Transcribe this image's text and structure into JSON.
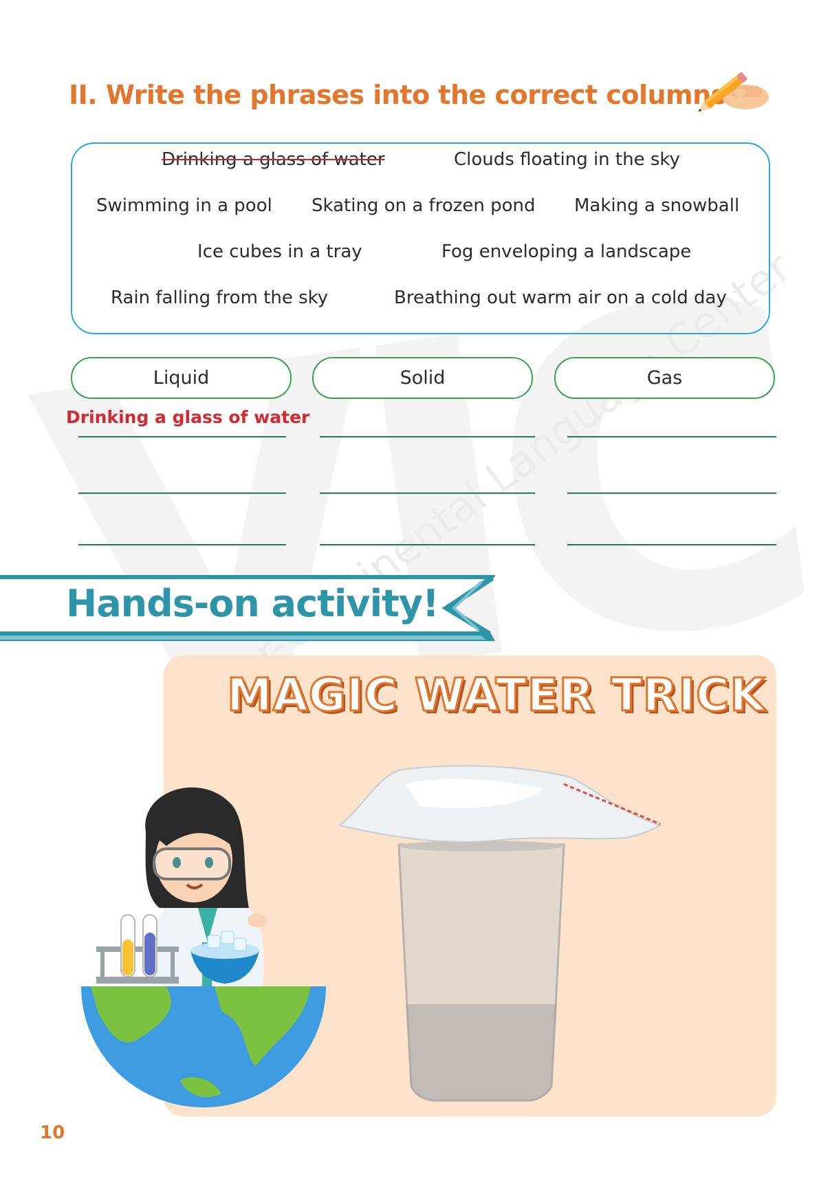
{
  "watermark": {
    "letters": "VIC",
    "text": "Inter-Continental Language Center"
  },
  "exercise": {
    "heading": "II. Write the phrases into the correct columns.",
    "phrases": [
      "Drinking a glass of water",
      "Clouds floating in the sky",
      "Swimming in a pool",
      "Skating on a frozen pond",
      "Making a snowball",
      "Ice cubes in a tray",
      "Fog enveloping a landscape",
      "Rain falling from the sky",
      "Breathing out warm air on a cold day"
    ],
    "columns": [
      "Liquid",
      "Solid",
      "Gas"
    ],
    "example_answer": "Drinking a glass of water"
  },
  "activity": {
    "banner_title": "Hands-on activity!",
    "title": "MAGIC WATER TRICK"
  },
  "page_number": "10",
  "colors": {
    "heading_orange": "#e2762c",
    "box_blue": "#29a8de",
    "pill_green": "#3aa24b",
    "answer_red": "#d22a30",
    "banner_teal": "#2e95a8",
    "panel_peach": "#fde3cc"
  }
}
